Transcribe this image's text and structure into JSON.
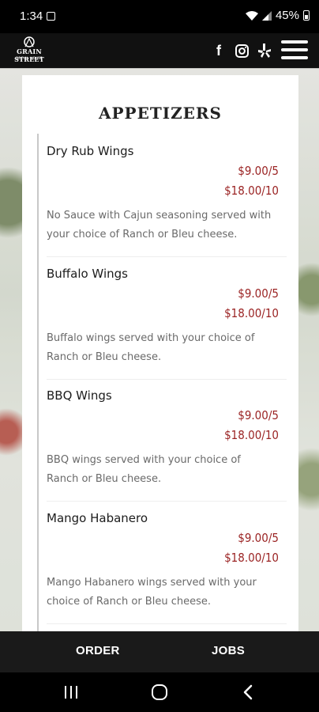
{
  "status": {
    "time": "1:34",
    "battery": "45%"
  },
  "header": {
    "logo_text": "GRAIN STREET",
    "logo_sub": "SOCIAL HOUSE",
    "social": [
      "facebook-icon",
      "instagram-icon",
      "yelp-icon"
    ]
  },
  "menu": {
    "title": "APPETIZERS",
    "items": [
      {
        "name": "Dry Rub Wings",
        "price1": "$9.00/5",
        "price2": "$18.00/10",
        "description": "No Sauce with Cajun seasoning served with your choice of Ranch or Bleu cheese."
      },
      {
        "name": "Buffalo Wings",
        "price1": "$9.00/5",
        "price2": "$18.00/10",
        "description": "Buffalo wings served with your choice of Ranch or Bleu cheese."
      },
      {
        "name": "BBQ Wings",
        "price1": "$9.00/5",
        "price2": "$18.00/10",
        "description": "BBQ wings served with your choice of Ranch or Bleu cheese."
      },
      {
        "name": "Mango Habanero",
        "price1": "$9.00/5",
        "price2": "$18.00/10",
        "description": "Mango Habanero wings served with your choice of Ranch or Bleu cheese."
      }
    ]
  },
  "bottom_bar": {
    "order_label": "ORDER",
    "jobs_label": "JOBS"
  },
  "colors": {
    "price": "#9b2424",
    "header_bg": "#111111"
  }
}
